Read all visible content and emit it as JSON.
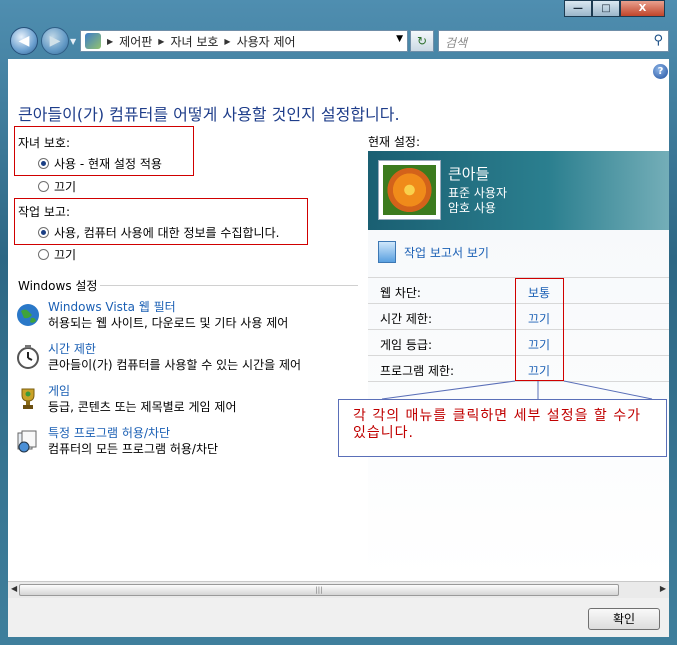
{
  "window": {
    "min": "—",
    "max": "□",
    "close": "X"
  },
  "nav": {
    "breadcrumbs": [
      "제어판",
      "자녀 보호",
      "사용자 제어"
    ],
    "search_placeholder": "검색"
  },
  "content": {
    "title": "큰아들이(가) 컴퓨터를 어떻게 사용할 것인지 설정합니다.",
    "parental": {
      "label": "자녀 보호:",
      "on_label": "사용 - 현재 설정 적용",
      "off_label": "끄기",
      "selected": "on"
    },
    "report": {
      "label": "작업 보고:",
      "on_label": "사용, 컴퓨터 사용에 대한 정보를 수집합니다.",
      "off_label": "끄기",
      "selected": "on"
    },
    "windows_settings_label": "Windows 설정",
    "settings": [
      {
        "icon": "globe-icon",
        "link": "Windows Vista 웹 필터",
        "desc": "허용되는 웹 사이트, 다운로드 및 기타 사용 제어"
      },
      {
        "icon": "clock-icon",
        "link": "시간 제한",
        "desc": "큰아들이(가) 컴퓨터를 사용할 수 있는 시간을 제어"
      },
      {
        "icon": "trophy-icon",
        "link": "게임",
        "desc": "등급, 콘텐츠 또는 제목별로 게임 제어"
      },
      {
        "icon": "program-icon",
        "link": "특정 프로그램 허용/차단",
        "desc": "컴퓨터의 모든 프로그램 허용/차단"
      }
    ]
  },
  "current": {
    "label": "현재 설정:",
    "user_name": "큰아들",
    "user_type": "표준 사용자",
    "password": "암호 사용",
    "report_link": "작업 보고서 보기",
    "rows": [
      {
        "label": "웹 차단:",
        "value": "보통"
      },
      {
        "label": "시간 제한:",
        "value": "끄기"
      },
      {
        "label": "게임 등급:",
        "value": "끄기"
      },
      {
        "label": "프로그램 제한:",
        "value": "끄기"
      }
    ]
  },
  "callout": "각 각의 매뉴를 클릭하면 세부 설정을 할 수가 있습니다.",
  "footer": {
    "ok_label": "확인"
  },
  "colors": {
    "link": "#1a5fb4",
    "title": "#1e3d8a",
    "annotation": "#d00000"
  }
}
